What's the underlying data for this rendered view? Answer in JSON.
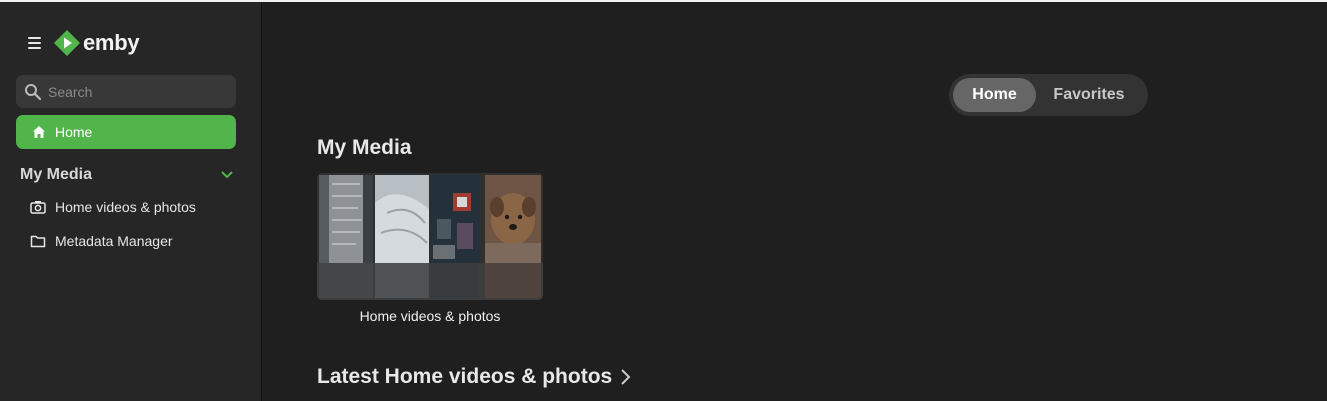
{
  "app": {
    "brand": "emby"
  },
  "sidebar": {
    "search_placeholder": "Search",
    "home_label": "Home",
    "section_title": "My Media",
    "items": [
      {
        "label": "Home videos & photos",
        "icon": "camera-icon"
      },
      {
        "label": "Metadata Manager",
        "icon": "folder-icon"
      }
    ]
  },
  "main": {
    "tabs": [
      {
        "label": "Home",
        "active": true
      },
      {
        "label": "Favorites",
        "active": false
      }
    ],
    "my_media_title": "My Media",
    "library_card_title": "Home videos & photos",
    "latest_title": "Latest Home videos & photos"
  },
  "colors": {
    "accent": "#52b54b",
    "sidebar_bg": "#262626",
    "main_bg": "#1f1f1f"
  }
}
